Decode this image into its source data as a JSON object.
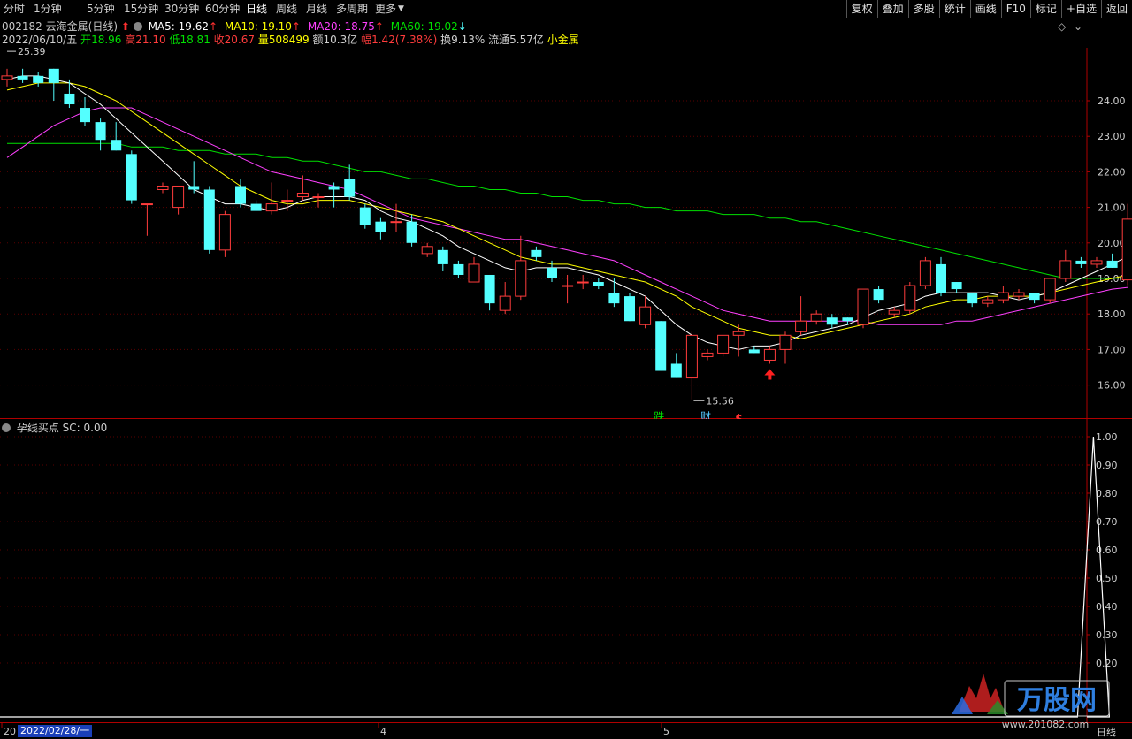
{
  "toolbar": {
    "periods": [
      "分时",
      "1分钟",
      "5分钟",
      "15分钟",
      "30分钟",
      "60分钟",
      "日线",
      "周线",
      "月线",
      "多周期",
      "更多"
    ],
    "active_period": "日线",
    "right_buttons": [
      "复权",
      "叠加",
      "多股",
      "统计",
      "画线",
      "F10",
      "标记",
      "+自选",
      "返回"
    ]
  },
  "stock": {
    "code": "002182",
    "name": "云海金属(日线)",
    "ma5": "MA5: 19.62",
    "ma10": "MA10: 19.10",
    "ma20": "MA20: 18.75",
    "ma60": "MA60: 19.02",
    "date": "2022/06/10/五",
    "open_label": "开",
    "open": "18.96",
    "high_label": "高",
    "high": "21.10",
    "low_label": "低",
    "low": "18.81",
    "close_label": "收",
    "close": "20.67",
    "vol_label": "量",
    "vol": "508499",
    "amt_label": "额",
    "amt": "10.3亿",
    "chg_label": "幅",
    "chg": "1.42(7.38%)",
    "turn_label": "换",
    "turn": "9.13%",
    "float_label": "流通",
    "float": "5.57亿",
    "tag": "小金属"
  },
  "chart_data": {
    "type": "candlestick",
    "price_axis": [
      "24.00",
      "23.00",
      "22.00",
      "21.00",
      "20.00",
      "19.00",
      "18.00",
      "17.00",
      "16.00"
    ],
    "ylim": [
      15.5,
      25.6
    ],
    "max_label": "25.39",
    "min_label": "15.56",
    "markers": [
      "跌",
      "财",
      "$"
    ],
    "candles": [
      [
        24.6,
        24.9,
        24.4,
        24.7
      ],
      [
        24.7,
        24.9,
        24.5,
        24.6
      ],
      [
        24.7,
        24.8,
        24.4,
        24.5
      ],
      [
        24.9,
        24.9,
        24.0,
        24.5
      ],
      [
        24.2,
        24.6,
        23.8,
        23.9
      ],
      [
        23.8,
        24.1,
        23.3,
        23.4
      ],
      [
        23.4,
        23.5,
        22.6,
        22.9
      ],
      [
        22.9,
        23.4,
        22.6,
        22.6
      ],
      [
        22.5,
        22.6,
        21.1,
        21.2
      ],
      [
        21.1,
        21.1,
        20.2,
        21.1
      ],
      [
        21.5,
        21.7,
        21.4,
        21.6
      ],
      [
        21.0,
        21.6,
        20.8,
        21.6
      ],
      [
        21.6,
        22.3,
        21.4,
        21.5
      ],
      [
        21.5,
        21.6,
        19.7,
        19.8
      ],
      [
        19.8,
        20.9,
        19.6,
        20.8
      ],
      [
        21.6,
        21.8,
        21.0,
        21.1
      ],
      [
        21.1,
        21.2,
        20.9,
        20.9
      ],
      [
        20.9,
        21.7,
        20.8,
        21.1
      ],
      [
        21.2,
        21.5,
        20.9,
        21.2
      ],
      [
        21.3,
        21.9,
        21.2,
        21.4
      ],
      [
        21.3,
        21.4,
        21.0,
        21.3
      ],
      [
        21.6,
        21.7,
        21.0,
        21.5
      ],
      [
        21.8,
        22.2,
        21.2,
        21.3
      ],
      [
        21.0,
        21.1,
        20.4,
        20.5
      ],
      [
        20.6,
        20.7,
        20.1,
        20.3
      ],
      [
        20.6,
        21.1,
        20.3,
        20.6
      ],
      [
        20.6,
        20.8,
        19.9,
        20.0
      ],
      [
        19.7,
        20.0,
        19.6,
        19.9
      ],
      [
        19.8,
        19.9,
        19.2,
        19.4
      ],
      [
        19.4,
        19.5,
        19.0,
        19.1
      ],
      [
        18.9,
        19.6,
        18.9,
        19.4
      ],
      [
        19.1,
        19.1,
        18.1,
        18.3
      ],
      [
        18.1,
        18.9,
        18.0,
        18.5
      ],
      [
        18.5,
        20.2,
        18.4,
        19.5
      ],
      [
        19.8,
        19.9,
        19.5,
        19.6
      ],
      [
        19.3,
        19.5,
        18.9,
        19.0
      ],
      [
        18.8,
        19.1,
        18.3,
        18.8
      ],
      [
        18.9,
        19.1,
        18.7,
        18.9
      ],
      [
        18.9,
        19.0,
        18.7,
        18.8
      ],
      [
        18.6,
        19.0,
        18.2,
        18.3
      ],
      [
        18.5,
        18.6,
        17.8,
        17.8
      ],
      [
        17.7,
        18.5,
        17.6,
        18.2
      ],
      [
        17.8,
        17.8,
        16.4,
        16.4
      ],
      [
        16.6,
        16.9,
        16.2,
        16.2
      ],
      [
        16.2,
        17.5,
        15.6,
        17.4
      ],
      [
        16.8,
        17.0,
        16.7,
        16.9
      ],
      [
        16.9,
        17.4,
        16.8,
        17.4
      ],
      [
        17.4,
        17.7,
        16.8,
        17.5
      ],
      [
        17.0,
        17.1,
        16.9,
        16.9
      ],
      [
        16.7,
        17.1,
        16.6,
        17.0
      ],
      [
        17.0,
        17.5,
        16.6,
        17.4
      ],
      [
        17.5,
        18.5,
        17.4,
        17.8
      ],
      [
        17.8,
        18.1,
        17.7,
        18.0
      ],
      [
        17.9,
        18.0,
        17.6,
        17.7
      ],
      [
        17.9,
        17.9,
        17.7,
        17.8
      ],
      [
        17.7,
        18.7,
        17.6,
        18.7
      ],
      [
        18.7,
        18.8,
        18.3,
        18.4
      ],
      [
        18.0,
        18.2,
        17.9,
        18.1
      ],
      [
        18.1,
        18.9,
        18.0,
        18.8
      ],
      [
        18.8,
        19.6,
        18.7,
        19.5
      ],
      [
        19.4,
        19.6,
        18.5,
        18.6
      ],
      [
        18.9,
        18.9,
        18.6,
        18.7
      ],
      [
        18.6,
        18.6,
        18.2,
        18.3
      ],
      [
        18.3,
        18.5,
        18.2,
        18.4
      ],
      [
        18.4,
        18.8,
        18.3,
        18.6
      ],
      [
        18.5,
        18.7,
        18.4,
        18.6
      ],
      [
        18.6,
        18.6,
        18.3,
        18.4
      ],
      [
        18.4,
        19.0,
        18.3,
        19.0
      ],
      [
        19.0,
        19.8,
        18.9,
        19.5
      ],
      [
        19.5,
        19.6,
        19.3,
        19.4
      ],
      [
        19.4,
        19.6,
        19.3,
        19.5
      ],
      [
        19.5,
        19.7,
        19.3,
        19.3
      ],
      [
        18.96,
        21.1,
        18.81,
        20.67
      ]
    ],
    "ma5": [
      24.6,
      24.7,
      24.7,
      24.6,
      24.5,
      24.2,
      23.9,
      23.5,
      23.1,
      22.7,
      22.3,
      21.9,
      21.5,
      21.3,
      21.1,
      21.1,
      21.0,
      20.9,
      21.0,
      21.2,
      21.3,
      21.3,
      21.3,
      21.2,
      20.9,
      20.7,
      20.6,
      20.4,
      20.2,
      19.9,
      19.7,
      19.5,
      19.3,
      19.2,
      19.3,
      19.3,
      19.3,
      19.2,
      19.1,
      18.9,
      18.7,
      18.5,
      18.1,
      17.7,
      17.4,
      17.2,
      17.1,
      17.0,
      17.1,
      17.1,
      17.2,
      17.4,
      17.5,
      17.6,
      17.7,
      17.9,
      18.1,
      18.2,
      18.3,
      18.5,
      18.6,
      18.6,
      18.6,
      18.6,
      18.5,
      18.4,
      18.5,
      18.6,
      18.8,
      19.0,
      19.2,
      19.4,
      19.62
    ],
    "ma10": [
      24.3,
      24.4,
      24.5,
      24.5,
      24.5,
      24.4,
      24.2,
      24.0,
      23.7,
      23.4,
      23.1,
      22.8,
      22.5,
      22.2,
      21.9,
      21.6,
      21.4,
      21.2,
      21.1,
      21.1,
      21.2,
      21.2,
      21.2,
      21.1,
      21.0,
      20.9,
      20.8,
      20.7,
      20.6,
      20.4,
      20.2,
      20.0,
      19.8,
      19.6,
      19.5,
      19.4,
      19.4,
      19.3,
      19.2,
      19.1,
      19.0,
      18.9,
      18.7,
      18.5,
      18.2,
      18.0,
      17.8,
      17.6,
      17.5,
      17.4,
      17.4,
      17.3,
      17.4,
      17.5,
      17.6,
      17.7,
      17.8,
      17.9,
      18.0,
      18.2,
      18.3,
      18.4,
      18.4,
      18.5,
      18.5,
      18.5,
      18.5,
      18.6,
      18.7,
      18.8,
      18.9,
      19.0,
      19.1
    ],
    "ma20": [
      22.4,
      22.7,
      23.0,
      23.3,
      23.5,
      23.7,
      23.8,
      23.8,
      23.8,
      23.6,
      23.4,
      23.2,
      23.0,
      22.8,
      22.6,
      22.4,
      22.2,
      22.0,
      21.9,
      21.8,
      21.7,
      21.6,
      21.5,
      21.3,
      21.1,
      20.9,
      20.7,
      20.6,
      20.5,
      20.4,
      20.3,
      20.2,
      20.1,
      20.1,
      20.0,
      19.9,
      19.8,
      19.7,
      19.6,
      19.5,
      19.3,
      19.1,
      18.9,
      18.7,
      18.5,
      18.3,
      18.1,
      18.0,
      17.9,
      17.8,
      17.8,
      17.8,
      17.8,
      17.8,
      17.8,
      17.8,
      17.7,
      17.7,
      17.7,
      17.7,
      17.7,
      17.8,
      17.8,
      17.9,
      18.0,
      18.1,
      18.2,
      18.3,
      18.4,
      18.5,
      18.6,
      18.7,
      18.75
    ],
    "ma60": [
      22.8,
      22.8,
      22.8,
      22.8,
      22.8,
      22.8,
      22.8,
      22.8,
      22.7,
      22.7,
      22.7,
      22.6,
      22.6,
      22.6,
      22.5,
      22.5,
      22.5,
      22.4,
      22.4,
      22.3,
      22.3,
      22.2,
      22.1,
      22.0,
      22.0,
      21.9,
      21.8,
      21.8,
      21.7,
      21.6,
      21.6,
      21.5,
      21.5,
      21.4,
      21.4,
      21.3,
      21.3,
      21.2,
      21.2,
      21.1,
      21.1,
      21.0,
      21.0,
      20.9,
      20.9,
      20.9,
      20.8,
      20.8,
      20.8,
      20.7,
      20.7,
      20.6,
      20.6,
      20.5,
      20.4,
      20.3,
      20.2,
      20.1,
      20.0,
      19.9,
      19.8,
      19.7,
      19.6,
      19.5,
      19.4,
      19.3,
      19.2,
      19.1,
      19.0,
      19.0,
      19.0,
      19.0,
      19.02
    ],
    "indicator": {
      "name": "孕线买点",
      "sc_label": "SC: 0.00",
      "axis": [
        "1.00",
        "0.90",
        "0.80",
        "0.70",
        "0.60",
        "0.50",
        "0.40",
        "0.30",
        "0.20"
      ],
      "ylim": [
        0,
        1.0
      ],
      "spike_at": 69,
      "spike_value": 1.0
    },
    "x_ticks": [
      "20",
      "4",
      "5"
    ],
    "date_range": "2022/02/28/一"
  },
  "colors": {
    "up": "#ff3c3c",
    "down": "#54ffff",
    "ma5": "#ffffff",
    "ma10": "#ffff00",
    "ma20": "#ff40ff",
    "ma60": "#00e000",
    "axis": "#b00000"
  },
  "footer": {
    "period_label": "日线",
    "watermark": "万股网",
    "watermark_url": "www.201082.com"
  }
}
